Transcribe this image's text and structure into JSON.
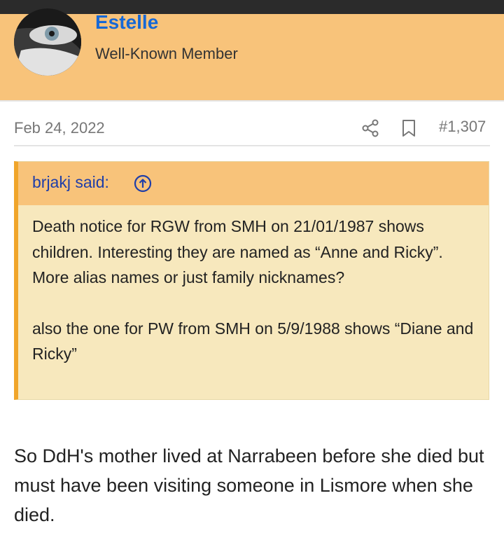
{
  "user": {
    "name": "Estelle",
    "title": "Well-Known Member"
  },
  "post": {
    "date": "Feb 24, 2022",
    "number": "#1,307"
  },
  "quote": {
    "author_label": "brjakj said:",
    "paragraphs": [
      "Death notice for RGW from SMH on 21/01/1987 shows children. Interesting they are named as “Anne and Ricky”. More alias names or just family nicknames?",
      "also the one for PW from SMH on 5/9/1988 shows “Diane and Ricky”"
    ]
  },
  "body": {
    "text": "So DdH's mother lived at Narrabeen before she died but must have been visiting someone in Lismore when she died."
  },
  "icons": {
    "share": "share-icon",
    "bookmark": "bookmark-icon",
    "jump": "arrow-up-circle-icon"
  },
  "colors": {
    "header_bg": "#f8c37a",
    "username": "#1668d6",
    "quote_bg": "#f7e8bd",
    "quote_border": "#f0a52a",
    "quote_author": "#1f3ea8"
  }
}
